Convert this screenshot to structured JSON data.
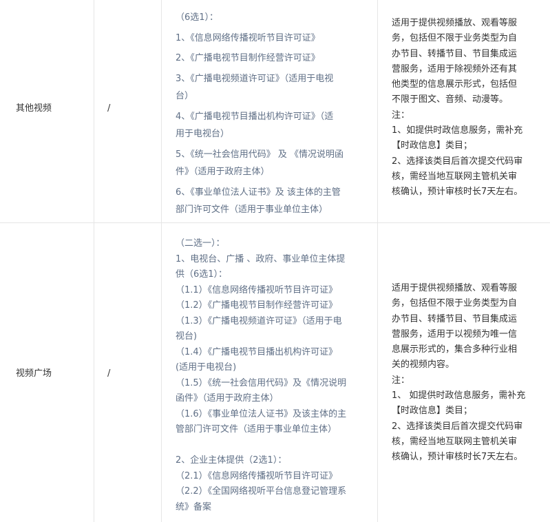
{
  "rows": [
    {
      "category": "其他视频",
      "slash": "/",
      "requirements": [
        "（6选1）：",
        "1、《信息网络传播视听节目许可证》",
        "2、《广播电视节目制作经营许可证》",
        "3、《广播电视频道许可证》（适用于电视",
        "台）",
        "4、《广播电视节目播出机构许可证》（适",
        "用于电视台）",
        "5、《统一社会信用代码》 及 《情况说明函",
        "件》（适用于政府主体）",
        "6、《事业单位法人证书》及 该主体的主管",
        "部门许可文件（适用于事业单位主体）"
      ],
      "description": [
        "适用于提供视频播放、观看等服",
        "务，包括但不限于业务类型为自",
        "办节目、转播节目、节目集成运",
        "营服务，适用于除视频外还有其",
        "他类型的信息展示形式，包括但",
        "不限于图文、音频、动漫等。",
        "注：",
        "1、如提供时政信息服务，需补充",
        "【时政信息】类目；",
        "2、选择该类目后首次提交代码审",
        "核，需经当地互联网主管机关审",
        "核确认，预计审核时长7天左右。"
      ]
    },
    {
      "category": "视频广场",
      "slash": "/",
      "requirements": [
        "（二选一）：",
        "1、电视台、广播 、政府、事业单位主体提",
        "供（6选1）：",
        "（1.1）《信息网络传播视听节目许可证》",
        "（1.2）《广播电视节目制作经营许可证》",
        "（1.3）《广播电视频道许可证》（适用于电",
        "视台)",
        "（1.4）《广播电视节目播出机构许可证》",
        "(适用于电视台)",
        "（1.5）《统一社会信用代码》及《情况说明",
        "函件》（适用于政府主体）",
        "（1.6）《事业单位法人证书》及该主体的主",
        "管部门许可文件（适用于事业单位主体）",
        "",
        "2、企业主体提供（2选1）：",
        "（2.1）《信息网络传播视听节目许可证》",
        "（2.2）《全国网络视听平台信息登记管理系",
        "统》备案"
      ],
      "description": [
        "适用于提供视频播放、观看等服",
        "务，包括但不限于业务类型为自",
        "办节目、转播节目、节目集成运",
        "营服务，适用于以视频为唯一信",
        "息展示形式的，集合多种行业相",
        "关的视频内容。",
        "注：",
        "1、 如提供时政信息服务，需补充",
        "【时政信息】类目；",
        "2、选择该类目后首次提交代码审",
        "核，需经当地互联网主管机关审",
        "核确认，预计审核时长7天左右。"
      ]
    }
  ]
}
